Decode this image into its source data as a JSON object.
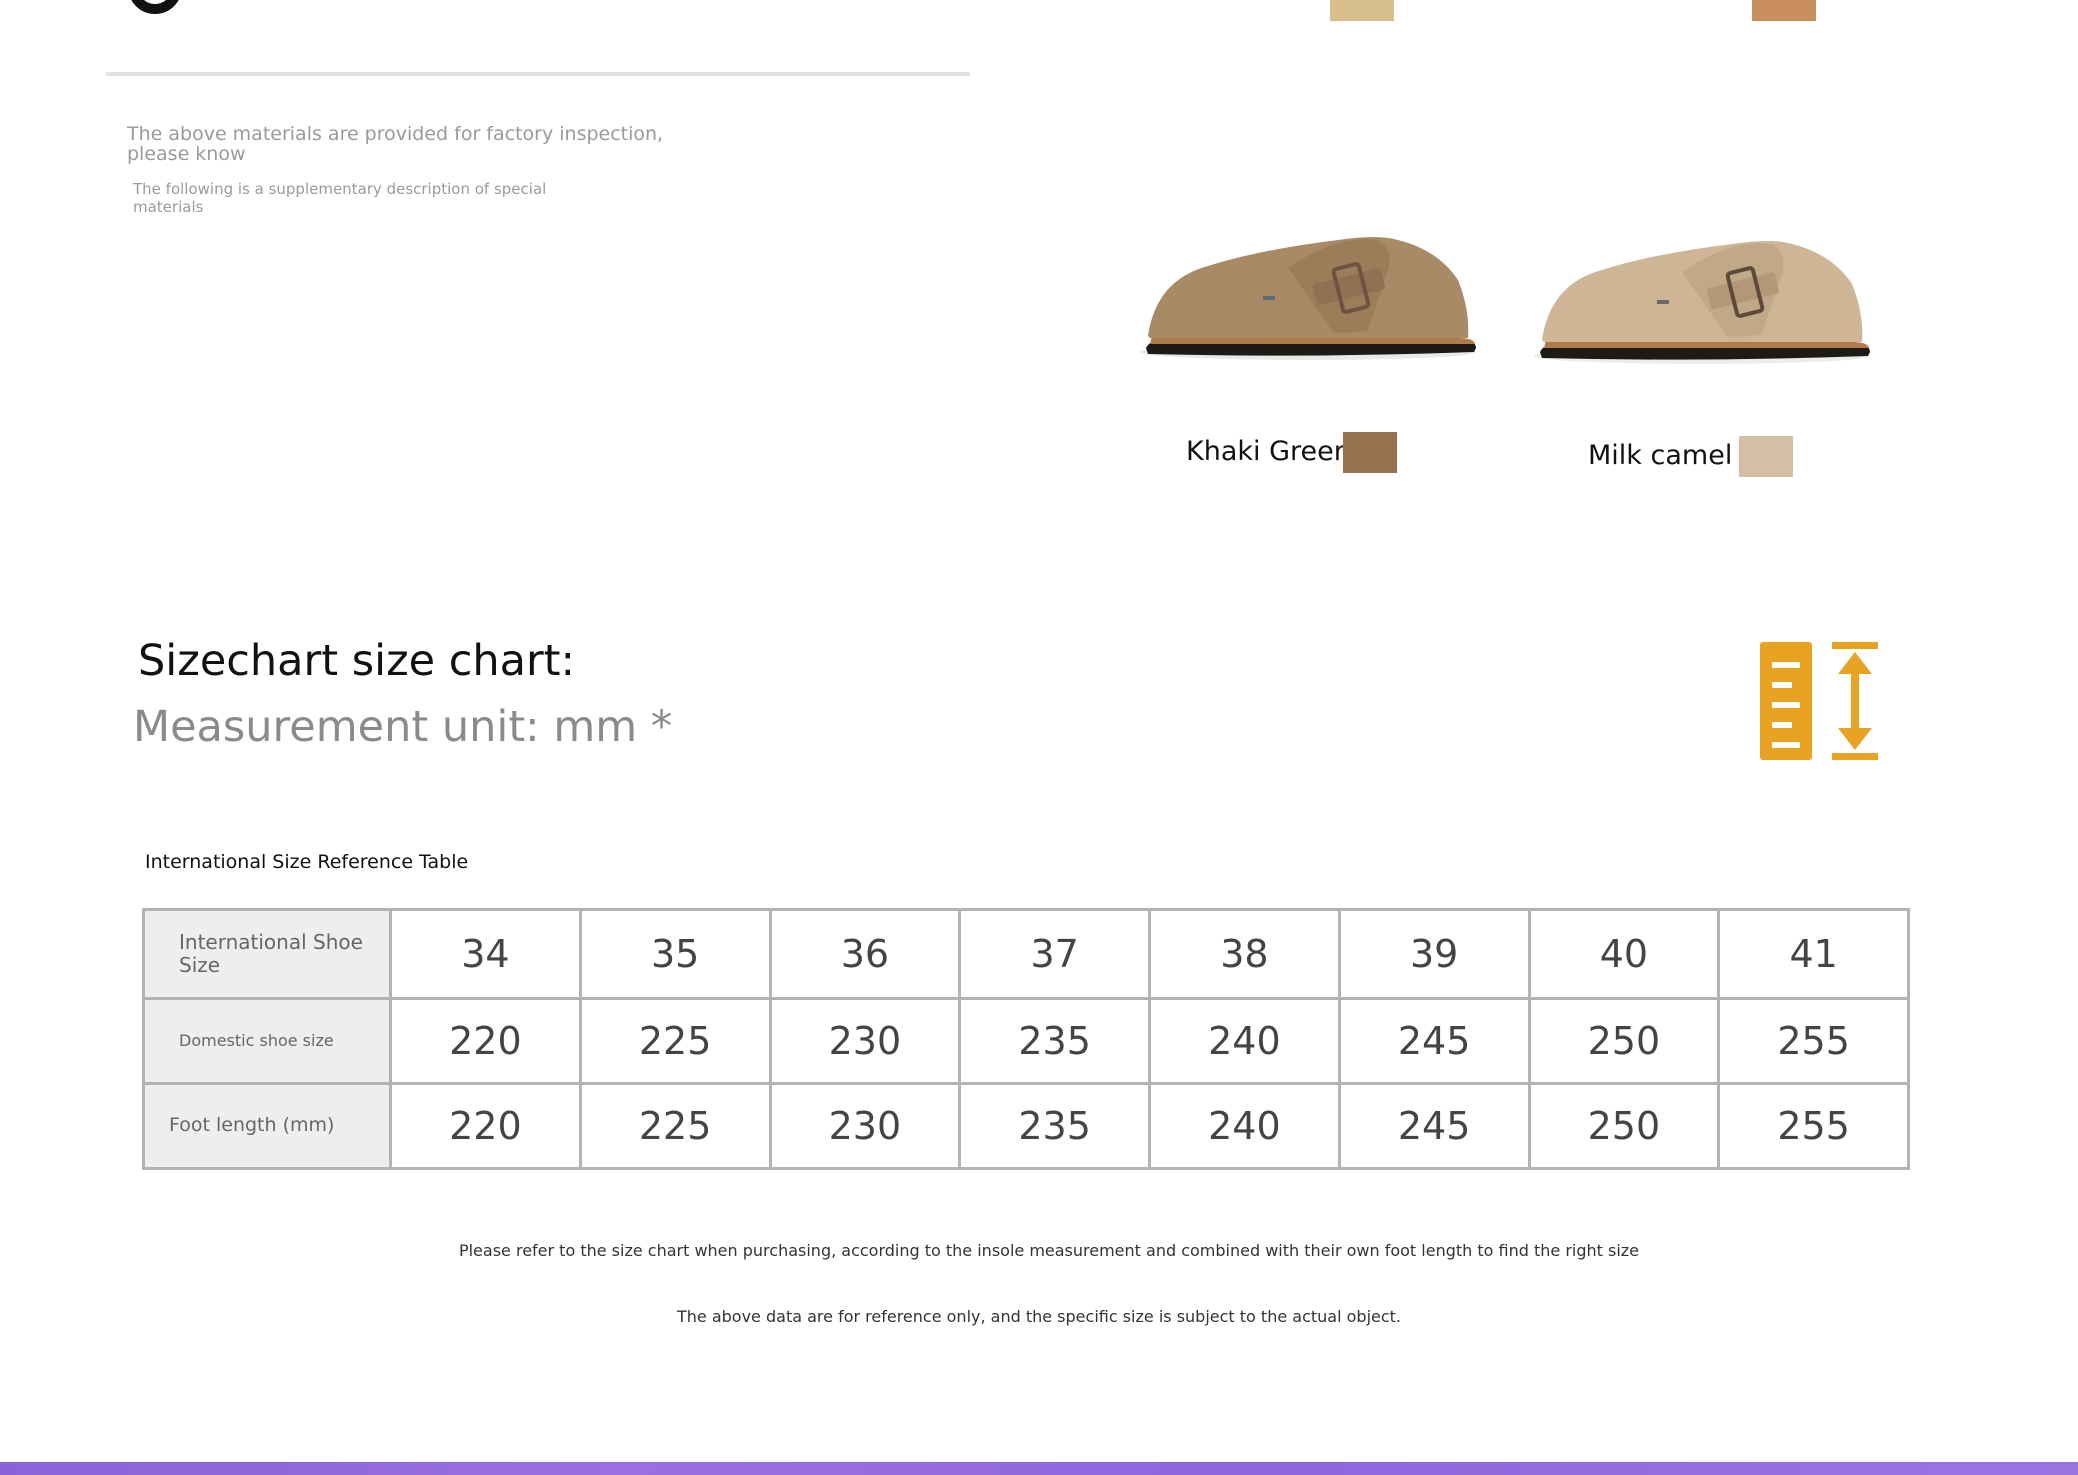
{
  "materials_notes": {
    "note1": "The above materials are provided for factory inspection, please know",
    "note2": "The following is a supplementary description of special materials"
  },
  "colors": [
    {
      "name": "Khaki Green",
      "swatch": "#97714f",
      "shoe_tone": "#a98a66"
    },
    {
      "name": "Milk camel",
      "swatch": "#d4bea4",
      "shoe_tone": "#cdb596"
    }
  ],
  "cropped_swatches": [
    "#d9bf8c",
    "#c98f5f"
  ],
  "size_chart": {
    "title": "Sizechart size chart:",
    "unit": "Measurement unit: mm *",
    "icon": "ruler-height-icon",
    "icon_color": "#e8a322",
    "table_caption": "International Size Reference Table",
    "rows": [
      {
        "label": "International Shoe Size",
        "values": [
          "34",
          "35",
          "36",
          "37",
          "38",
          "39",
          "40",
          "41"
        ]
      },
      {
        "label": "Domestic shoe size",
        "values": [
          "220",
          "225",
          "230",
          "235",
          "240",
          "245",
          "250",
          "255"
        ]
      },
      {
        "label": "Foot length (mm)",
        "values": [
          "220",
          "225",
          "230",
          "235",
          "240",
          "245",
          "250",
          "255"
        ]
      }
    ]
  },
  "footnotes": {
    "line1": "Please refer to the size chart when purchasing, according to the insole measurement and combined with their own foot length to find the right size",
    "line2": "The above data are for reference only, and the specific size is subject to the actual object."
  },
  "accent_bar_color": "#8f66dd"
}
